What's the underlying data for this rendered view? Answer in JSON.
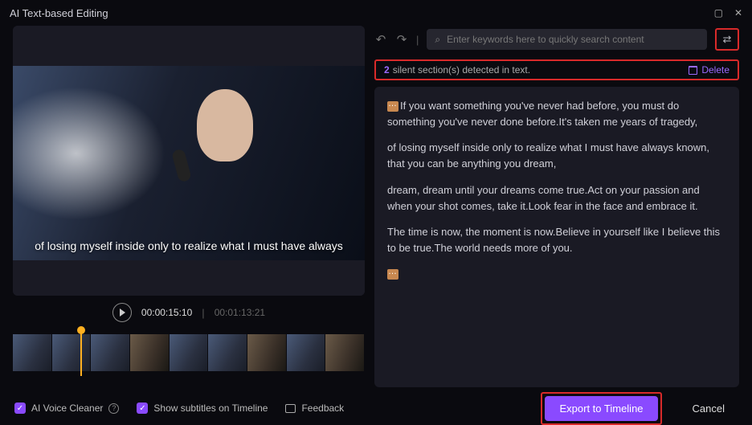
{
  "titlebar": {
    "title": "AI Text-based Editing"
  },
  "video": {
    "subtitle": "of losing myself inside only to realize what I must have always",
    "current_time": "00:00:15:10",
    "duration": "00:01:13:21"
  },
  "search": {
    "placeholder": "Enter keywords here to quickly search content"
  },
  "notice": {
    "count": "2",
    "text": "silent section(s) detected in text.",
    "delete_label": "Delete"
  },
  "transcript": {
    "p1": "If you want something you've never had before, you must do something you've never done before.It's taken me years of tragedy,",
    "p2": " of losing myself inside only to realize what I must have always known, that you can be anything you dream,",
    "p3": " dream, dream until your dreams come true.Act on your passion and when your shot comes, take it.Look fear in the face and embrace it.",
    "p4": "The time is now, the moment is now.Believe in yourself like I believe this to be true.The world needs more of you."
  },
  "footer": {
    "voice_cleaner": "AI Voice Cleaner",
    "show_subtitles": "Show subtitles on Timeline",
    "feedback": "Feedback",
    "export": "Export to Timeline",
    "cancel": "Cancel"
  }
}
